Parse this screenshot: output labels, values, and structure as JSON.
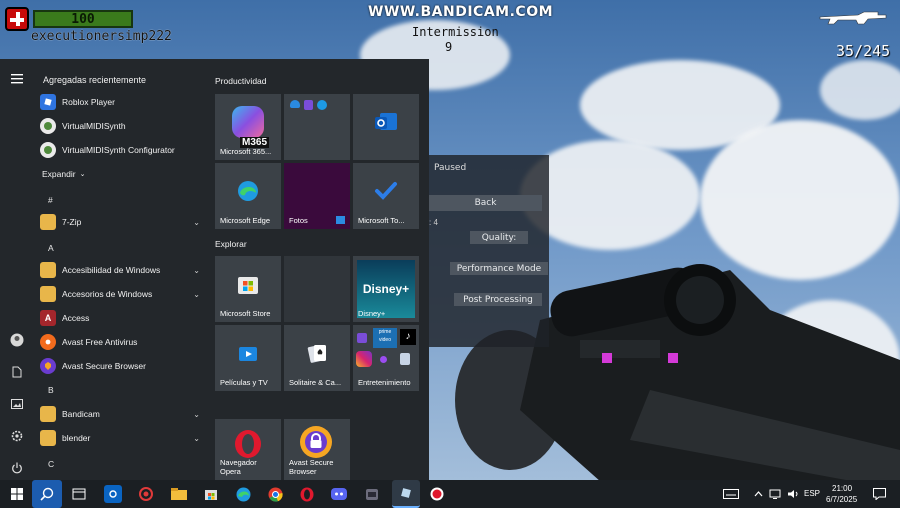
{
  "game": {
    "health": "100",
    "player_name": "executionersimp222",
    "watermark": "WWW.BANDICAM.COM",
    "round_status": "Intermission",
    "round_timer": "9",
    "ammo": "35/245",
    "pause_menu": {
      "title": "Paused",
      "buttons": [
        "Back",
        "Quality:",
        "Performance Mode",
        "Post Processing"
      ],
      "partial_text": ": 4"
    }
  },
  "start_menu": {
    "recent_heading": "Agregadas recientemente",
    "recent": [
      "Roblox Player",
      "VirtualMIDISynth",
      "VirtualMIDISynth Configurator"
    ],
    "expand_label": "Expandir",
    "letters": [
      "#",
      "A",
      "B",
      "C"
    ],
    "apps": [
      {
        "label": "7-Zip",
        "type": "folder"
      },
      {
        "label": "Accesibilidad de Windows",
        "type": "folder"
      },
      {
        "label": "Accesorios de Windows",
        "type": "folder"
      },
      {
        "label": "Access",
        "type": "app"
      },
      {
        "label": "Avast Free Antivirus",
        "type": "app"
      },
      {
        "label": "Avast Secure Browser",
        "type": "app"
      },
      {
        "label": "Bandicam",
        "type": "folder"
      },
      {
        "label": "blender",
        "type": "folder"
      }
    ],
    "groups": [
      "Productividad",
      "Explorar"
    ],
    "tiles": {
      "m365": "Microsoft 365...",
      "m365_badge": "M365",
      "edge": "Microsoft Edge",
      "fotos": "Fotos",
      "todo": "Microsoft To...",
      "store": "Microsoft Store",
      "disney": "Disney+",
      "disney_logo": "Disney+",
      "peliculas": "Películas y TV",
      "solitaire": "Solitaire & Ca...",
      "entretenimiento": "Entretenimiento",
      "prime_text": "prime video",
      "opera": "Navegador Opera",
      "avast_browser": "Avast Secure Browser"
    }
  },
  "taskbar": {
    "language": "ESP",
    "time": "21:00",
    "date": "6/7/2025"
  }
}
